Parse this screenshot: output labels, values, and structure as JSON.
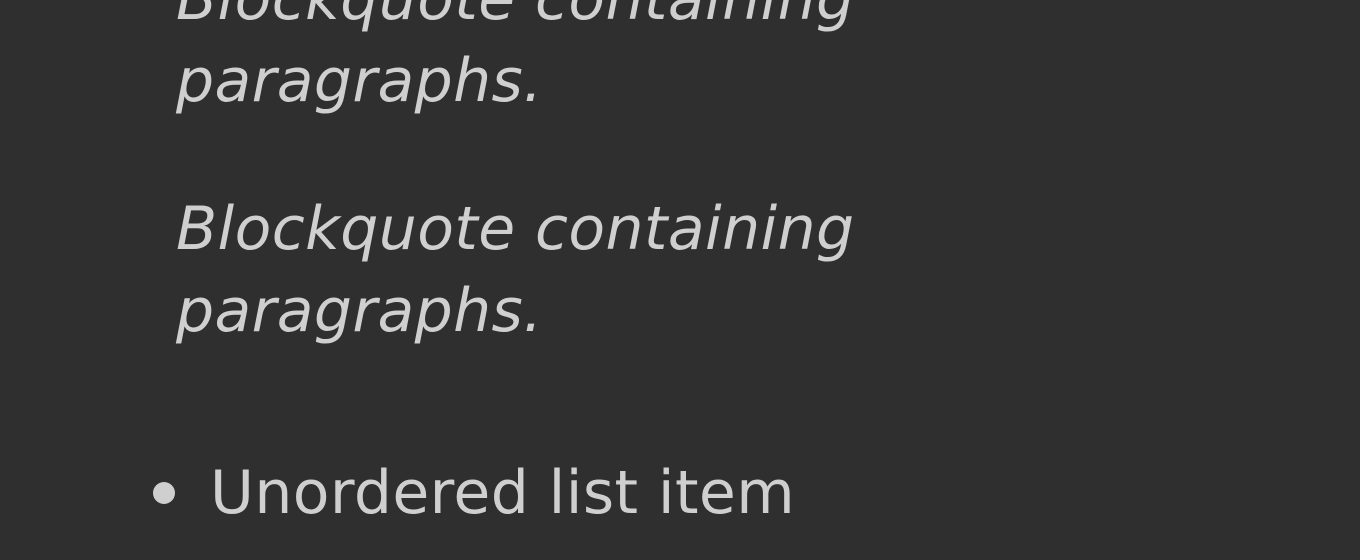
{
  "blockquote": {
    "paragraphs": [
      "Blockquote containing paragraphs.",
      "Blockquote containing paragraphs."
    ]
  },
  "unordered_list": {
    "items": [
      "Unordered list item"
    ]
  }
}
